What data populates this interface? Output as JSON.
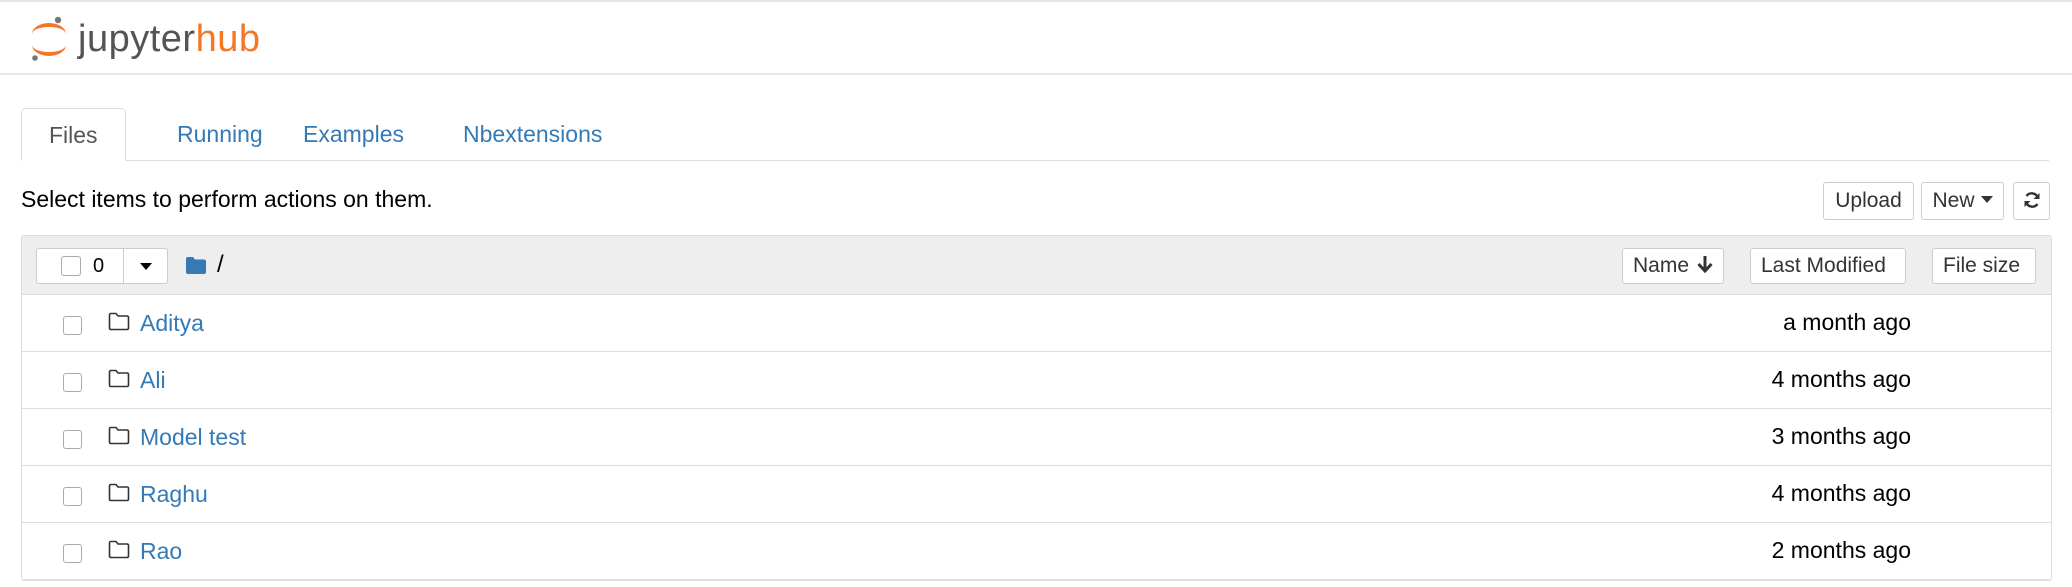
{
  "header": {
    "logo_text_main": "jupyter",
    "logo_text_accent": "hub"
  },
  "tabs": [
    {
      "label": "Files",
      "active": true
    },
    {
      "label": "Running",
      "active": false
    },
    {
      "label": "Examples",
      "active": false
    },
    {
      "label": "Nbextensions",
      "active": false
    }
  ],
  "toolbar": {
    "instructions": "Select items to perform actions on them.",
    "upload_label": "Upload",
    "new_label": "New",
    "refresh_icon": "refresh-icon"
  },
  "list_header": {
    "selected_count": "0",
    "breadcrumb_path": "/",
    "sort_name_label": "Name",
    "sort_modified_label": "Last Modified",
    "sort_size_label": "File size"
  },
  "rows": [
    {
      "name": "Aditya",
      "modified": "a month ago"
    },
    {
      "name": "Ali",
      "modified": "4 months ago"
    },
    {
      "name": "Model test",
      "modified": "3 months ago"
    },
    {
      "name": "Raghu",
      "modified": "4 months ago"
    },
    {
      "name": "Rao",
      "modified": "2 months ago"
    }
  ],
  "colors": {
    "link": "#337ab7",
    "brand_orange": "#f37726",
    "brand_gray": "#545454"
  }
}
